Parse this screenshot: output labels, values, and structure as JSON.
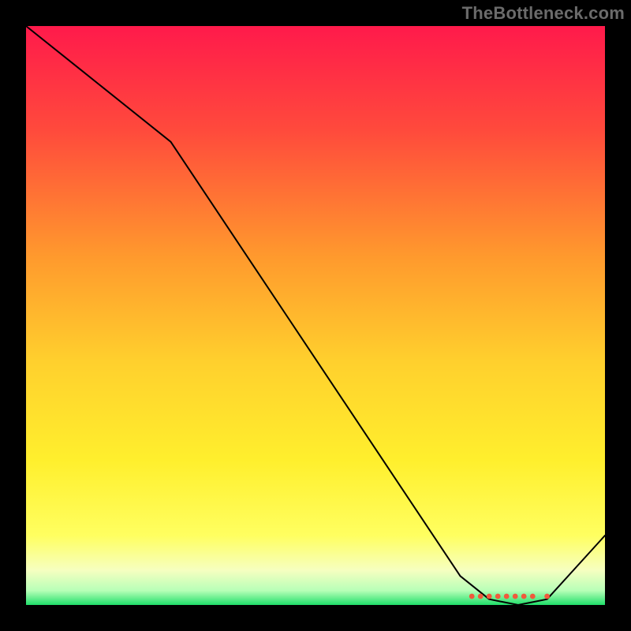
{
  "watermark": "TheBottleneck.com",
  "chart_data": {
    "type": "line",
    "title": "",
    "xlabel": "",
    "ylabel": "",
    "xlim": [
      0,
      100
    ],
    "ylim": [
      0,
      100
    ],
    "grid": false,
    "legend": false,
    "series": [
      {
        "name": "curve",
        "x": [
          0,
          10,
          25,
          35,
          45,
          55,
          65,
          75,
          80,
          85,
          90,
          100
        ],
        "y": [
          100,
          92,
          80,
          65,
          50,
          35,
          20,
          5,
          1,
          0,
          1,
          12
        ],
        "color": "#000000",
        "width": 2
      }
    ],
    "markers": {
      "name": "baseline-cluster",
      "color": "#f05a3c",
      "radius": 3.4,
      "points": [
        {
          "x": 77,
          "y": 1.5
        },
        {
          "x": 78.5,
          "y": 1.5
        },
        {
          "x": 80,
          "y": 1.5
        },
        {
          "x": 81.5,
          "y": 1.5
        },
        {
          "x": 83,
          "y": 1.5
        },
        {
          "x": 84.5,
          "y": 1.5
        },
        {
          "x": 86,
          "y": 1.5
        },
        {
          "x": 87.5,
          "y": 1.5
        },
        {
          "x": 90,
          "y": 1.5
        }
      ]
    },
    "gradient_stops": [
      {
        "offset": 0.0,
        "color": "#ff1a4b"
      },
      {
        "offset": 0.18,
        "color": "#ff4a3c"
      },
      {
        "offset": 0.4,
        "color": "#ff9a2d"
      },
      {
        "offset": 0.58,
        "color": "#ffd02d"
      },
      {
        "offset": 0.75,
        "color": "#ffef2d"
      },
      {
        "offset": 0.88,
        "color": "#ffff60"
      },
      {
        "offset": 0.94,
        "color": "#f6ffc0"
      },
      {
        "offset": 0.975,
        "color": "#b8ffb8"
      },
      {
        "offset": 1.0,
        "color": "#20df6a"
      }
    ]
  }
}
